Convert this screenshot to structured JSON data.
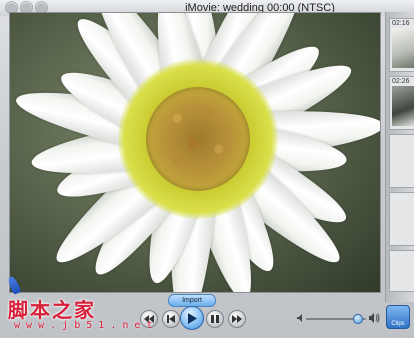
{
  "window": {
    "title": "iMovie: wedding  00:00 (NTSC)"
  },
  "clips_pane": {
    "clips": [
      {
        "time": "02:16"
      },
      {
        "time": "02:26"
      }
    ],
    "button_label": "Clips"
  },
  "controls": {
    "import_label": "Import",
    "volume_level": 0.85
  },
  "watermark": {
    "main": "脚本之家",
    "url": "w w w . j b 5 1 . n e t"
  },
  "colors": {
    "accent": "#3b82cc",
    "watermark": "#d7213a"
  }
}
